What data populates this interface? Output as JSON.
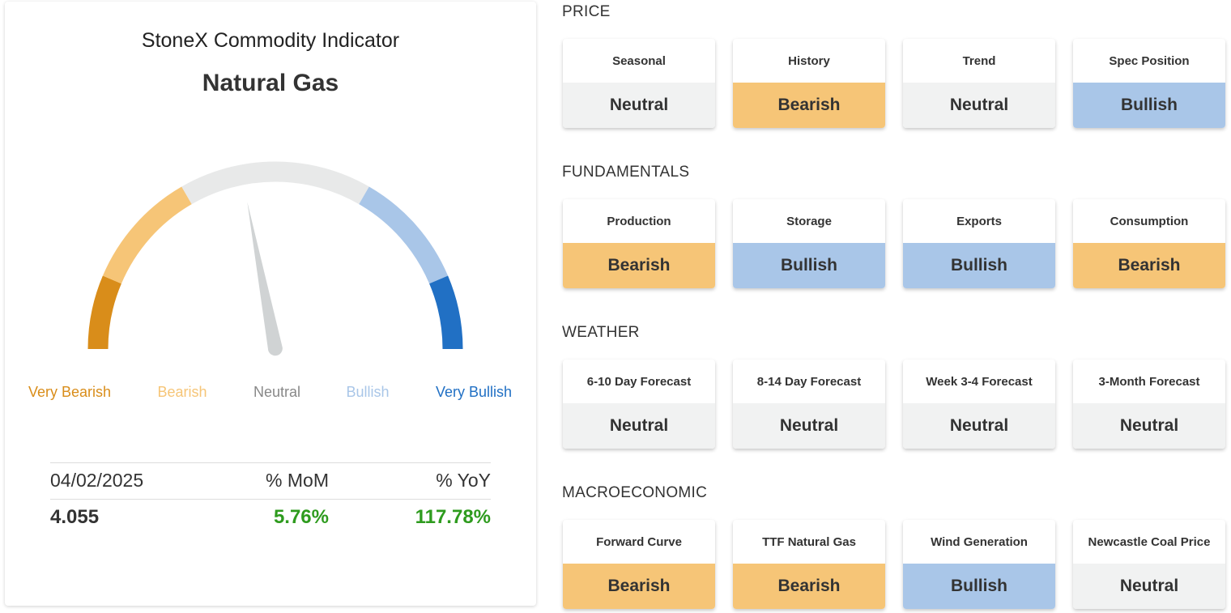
{
  "indicator": {
    "title": "StoneX Commodity Indicator",
    "commodity": "Natural Gas",
    "needle_level": 0.44,
    "gauge_labels": [
      {
        "label": "Very Bearish",
        "color": "#d98d1a"
      },
      {
        "label": "Bearish",
        "color": "#f6c577"
      },
      {
        "label": "Neutral",
        "color": "#888888"
      },
      {
        "label": "Bullish",
        "color": "#a9c6e8"
      },
      {
        "label": "Very Bullish",
        "color": "#2170c4"
      }
    ],
    "segment_colors": [
      "#d98d1a",
      "#f6c577",
      "#e8e9e9",
      "#a9c6e8",
      "#2170c4"
    ],
    "stats": {
      "date": "04/02/2025",
      "mom_label": "% MoM",
      "yoy_label": "% YoY",
      "price": "4.055",
      "mom": "5.76%",
      "yoy": "117.78%"
    }
  },
  "status_colors": {
    "Neutral": "#f1f2f2",
    "Bearish": "#f6c577",
    "Bullish": "#a9c6e8"
  },
  "sections": [
    {
      "title": "PRICE",
      "tiles": [
        {
          "label": "Seasonal",
          "status": "Neutral"
        },
        {
          "label": "History",
          "status": "Bearish"
        },
        {
          "label": "Trend",
          "status": "Neutral"
        },
        {
          "label": "Spec Position",
          "status": "Bullish"
        }
      ]
    },
    {
      "title": "FUNDAMENTALS",
      "tiles": [
        {
          "label": "Production",
          "status": "Bearish"
        },
        {
          "label": "Storage",
          "status": "Bullish"
        },
        {
          "label": "Exports",
          "status": "Bullish"
        },
        {
          "label": "Consumption",
          "status": "Bearish"
        }
      ]
    },
    {
      "title": "WEATHER",
      "tiles": [
        {
          "label": "6-10 Day Forecast",
          "status": "Neutral"
        },
        {
          "label": "8-14 Day Forecast",
          "status": "Neutral"
        },
        {
          "label": "Week 3-4 Forecast",
          "status": "Neutral"
        },
        {
          "label": "3-Month Forecast",
          "status": "Neutral"
        }
      ]
    },
    {
      "title": "MACROECONOMIC",
      "tiles": [
        {
          "label": "Forward Curve",
          "status": "Bearish"
        },
        {
          "label": "TTF Natural Gas",
          "status": "Bearish"
        },
        {
          "label": "Wind Generation",
          "status": "Bullish"
        },
        {
          "label": "Newcastle Coal Price",
          "status": "Neutral"
        }
      ]
    }
  ]
}
